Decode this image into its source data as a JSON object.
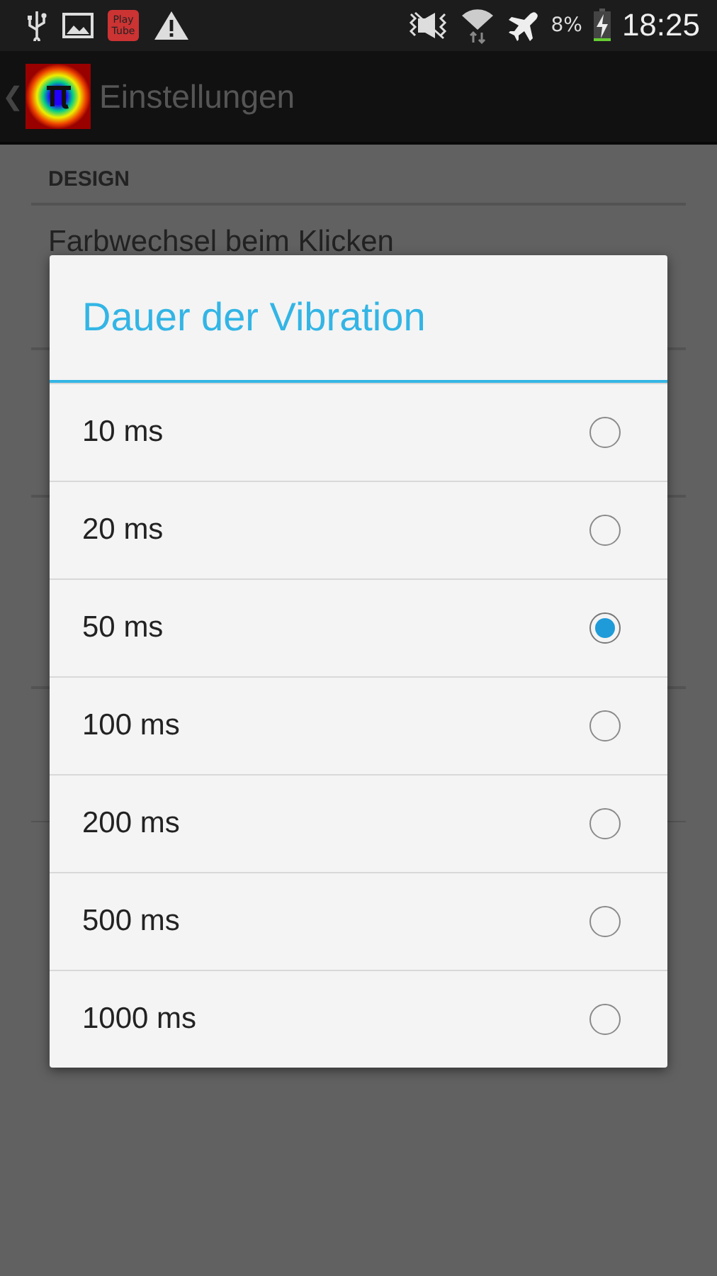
{
  "status_bar": {
    "app_badge": [
      "Play",
      "Tube"
    ],
    "battery_text": "8%",
    "time": "18:25"
  },
  "action_bar": {
    "back": "❮",
    "title": "Einstellungen"
  },
  "background": {
    "section": "DESIGN",
    "item": "Farbwechsel beim Klicken"
  },
  "dialog": {
    "title": "Dauer der Vibration",
    "options": [
      {
        "label": "10 ms",
        "selected": false
      },
      {
        "label": "20 ms",
        "selected": false
      },
      {
        "label": "50 ms",
        "selected": true
      },
      {
        "label": "100 ms",
        "selected": false
      },
      {
        "label": "200 ms",
        "selected": false
      },
      {
        "label": "500 ms",
        "selected": false
      },
      {
        "label": "1000 ms",
        "selected": false
      }
    ]
  }
}
